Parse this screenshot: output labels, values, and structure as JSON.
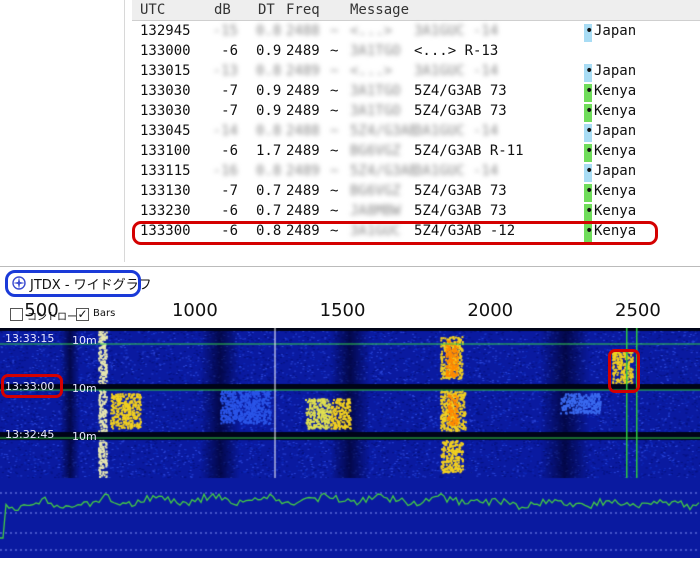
{
  "decode_table": {
    "headers": {
      "utc": "UTC",
      "db": "dB",
      "dt": "DT",
      "freq": "Freq",
      "message": "Message"
    },
    "rows": [
      {
        "utc": "132945",
        "db": "-15",
        "dt": "0.8",
        "freq": "2488",
        "sep": "~",
        "msg_call": "<...>",
        "msg_rest": "3A1GUC -14",
        "blurred": true,
        "country": "Japan",
        "country_color": "#a8dcf4"
      },
      {
        "utc": "133000",
        "db": "-6",
        "dt": "0.9",
        "freq": "2489",
        "sep": "~",
        "msg_call": "3A1TGO",
        "msg_rest": "<...> R-13",
        "blurred": false,
        "country": "",
        "country_color": ""
      },
      {
        "utc": "133015",
        "db": "-13",
        "dt": "0.8",
        "freq": "2489",
        "sep": "~",
        "msg_call": "<...>",
        "msg_rest": "3A1GUC -14",
        "blurred": true,
        "country": "Japan",
        "country_color": "#a8dcf4"
      },
      {
        "utc": "133030",
        "db": "-7",
        "dt": "0.9",
        "freq": "2489",
        "sep": "~",
        "msg_call": "3A1TGO",
        "msg_rest": "5Z4/G3AB 73",
        "blurred": false,
        "country": "Kenya",
        "country_color": "#6fdc5a"
      },
      {
        "utc": "133030",
        "db": "-7",
        "dt": "0.9",
        "freq": "2489",
        "sep": "~",
        "msg_call": "3A1TGO",
        "msg_rest": "5Z4/G3AB 73",
        "blurred": false,
        "country": "Kenya",
        "country_color": "#6fdc5a"
      },
      {
        "utc": "133045",
        "db": "-14",
        "dt": "0.8",
        "freq": "2488",
        "sep": "~",
        "msg_call": "5Z4/G3AB",
        "msg_rest": "3A1GUC -14",
        "blurred": true,
        "country": "Japan",
        "country_color": "#a8dcf4"
      },
      {
        "utc": "133100",
        "db": "-6",
        "dt": "1.7",
        "freq": "2489",
        "sep": "~",
        "msg_call": "BG6VGZ",
        "msg_rest": "5Z4/G3AB R-11",
        "blurred": false,
        "country": "Kenya",
        "country_color": "#6fdc5a"
      },
      {
        "utc": "133115",
        "db": "-16",
        "dt": "0.8",
        "freq": "2489",
        "sep": "~",
        "msg_call": "5Z4/G3AB",
        "msg_rest": "3A1GUC -14",
        "blurred": true,
        "country": "Japan",
        "country_color": "#a8dcf4"
      },
      {
        "utc": "133130",
        "db": "-7",
        "dt": "0.7",
        "freq": "2489",
        "sep": "~",
        "msg_call": "BG6VGZ",
        "msg_rest": "5Z4/G3AB 73",
        "blurred": false,
        "country": "Kenya",
        "country_color": "#6fdc5a"
      },
      {
        "utc": "133230",
        "db": "-6",
        "dt": "0.7",
        "freq": "2489",
        "sep": "~",
        "msg_call": "JA8MBW",
        "msg_rest": "5Z4/G3AB 73",
        "blurred": false,
        "country": "Kenya",
        "country_color": "#6fdc5a"
      },
      {
        "utc": "133300",
        "db": "-6",
        "dt": "0.8",
        "freq": "2489",
        "sep": "~",
        "msg_call": "3A1GUC",
        "msg_rest": "5Z4/G3AB -12",
        "blurred": false,
        "country": "Kenya",
        "country_color": "#6fdc5a"
      }
    ]
  },
  "wide_graph": {
    "title": "JTDX - ワイドグラフ",
    "freq_labels": [
      "500",
      "1000",
      "1500",
      "2000",
      "2500"
    ],
    "freq_range": [
      350,
      2720
    ],
    "controls": [
      {
        "label": "コントロー",
        "checked": false
      },
      {
        "label": "Bars",
        "checked": true
      }
    ],
    "time_markers": [
      {
        "time": "13:33:15",
        "interval": "10m"
      },
      {
        "time": "13:33:00",
        "interval": "10m"
      },
      {
        "time": "13:32:45",
        "interval": "10m"
      }
    ],
    "highlight_freq": 2489,
    "colors": {
      "waterfall_bg": "#0a1aa0",
      "signal": "#f2d020",
      "spectrum": "#44cc44",
      "marker": "#2ecc40",
      "annotation_red": "#d40000",
      "annotation_blue": "#1a3ad8"
    }
  }
}
